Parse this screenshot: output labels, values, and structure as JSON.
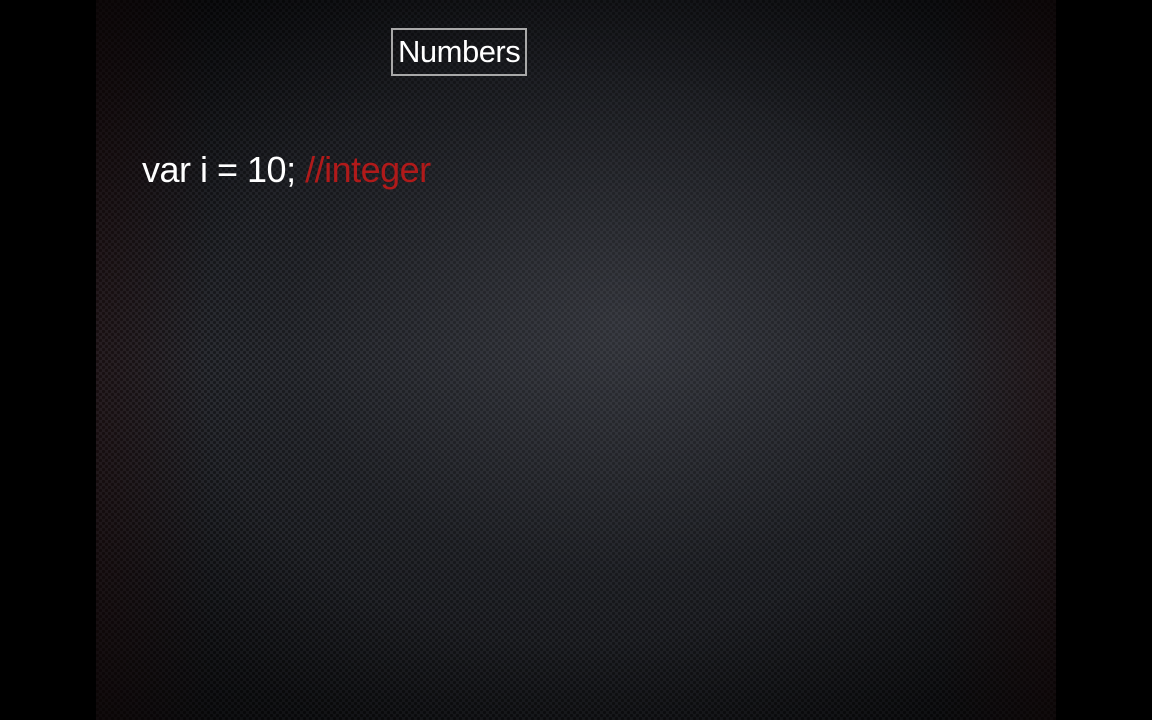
{
  "slide": {
    "title": "Numbers",
    "code": {
      "statement": "var i = 10; ",
      "comment": "//integer"
    }
  },
  "colors": {
    "background": "#000000",
    "text": "#ffffff",
    "comment": "#b01a1a",
    "title_border": "#a8a8a8"
  }
}
